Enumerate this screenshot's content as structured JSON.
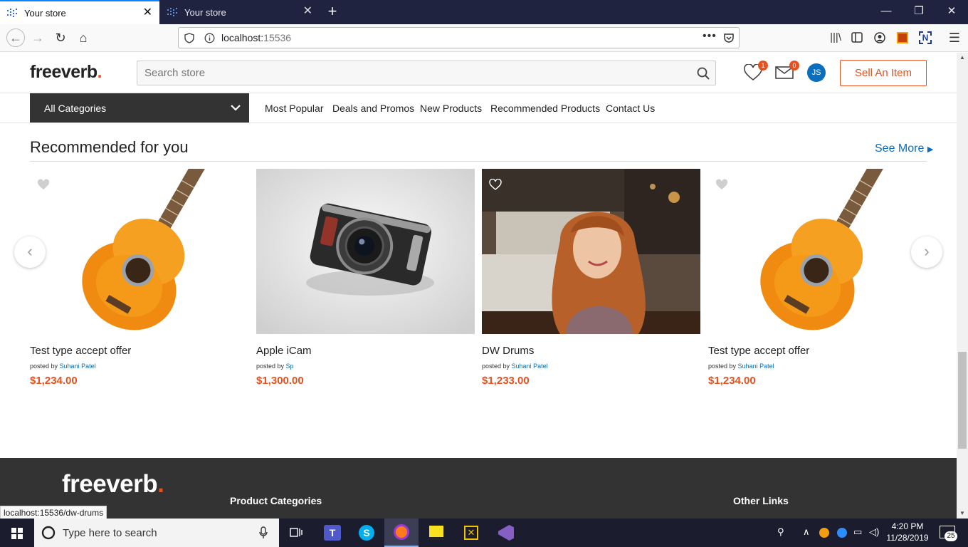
{
  "browser": {
    "tabs": [
      {
        "title": "Your store",
        "active": true
      },
      {
        "title": "Your store",
        "active": false
      }
    ],
    "url": "localhost:",
    "url_port": "15536",
    "status_url": "localhost:15536/dw-drums"
  },
  "header": {
    "logo_text": "freeverb",
    "logo_dot": ".",
    "search_placeholder": "Search store",
    "wishlist_count": "1",
    "messages_count": "0",
    "avatar_initials": "JS",
    "sell_button": "Sell An Item"
  },
  "nav": {
    "categories_label": "All Categories",
    "menu": [
      "Most Popular",
      "Deals and Promos",
      "New Products",
      "Recommended Products",
      "Contact Us"
    ]
  },
  "section": {
    "title": "Recommended for you",
    "see_more": "See More"
  },
  "products": [
    {
      "title": "Test type accept offer",
      "posted_by_label": "posted by",
      "author": "Suhani Patel",
      "price": "$1,234.00",
      "image": "guitar"
    },
    {
      "title": "Apple iCam",
      "posted_by_label": "posted by",
      "author": "Sp",
      "price": "$1,300.00",
      "image": "camera"
    },
    {
      "title": "DW Drums",
      "posted_by_label": "posted by",
      "author": "Suhani Patel",
      "price": "$1,233.00",
      "image": "woman-portrait"
    },
    {
      "title": "Test type accept offer",
      "posted_by_label": "posted by",
      "author": "Suhani Patel",
      "price": "$1,234.00",
      "image": "guitar"
    }
  ],
  "footer": {
    "logo_text": "freeverb",
    "logo_dot": ".",
    "col1_heading": "Product Categories",
    "col2_heading": "Other Links"
  },
  "taskbar": {
    "search_placeholder": "Type here to search",
    "time": "4:20 PM",
    "date": "11/28/2019",
    "notification_count": "25"
  },
  "colors": {
    "accent": "#e8501d",
    "link": "#0a6ebd",
    "dark": "#333333"
  }
}
